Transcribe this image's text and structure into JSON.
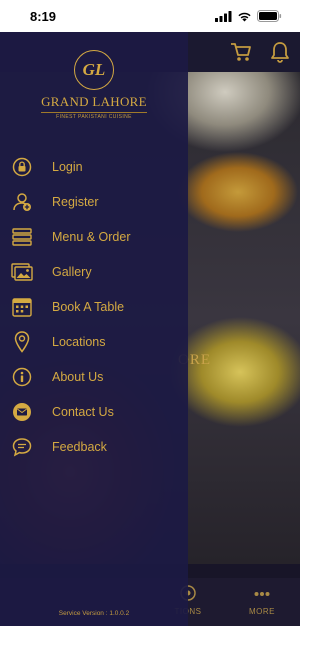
{
  "status_bar": {
    "time": "8:19"
  },
  "app": {
    "background_text": "ORE",
    "bottom_nav": [
      {
        "label": "TIONS",
        "icon": "location-pin-icon"
      },
      {
        "label": "MORE",
        "icon": "more-dots-icon"
      }
    ]
  },
  "drawer": {
    "logo": {
      "monogram": "GL",
      "name": "GRAND LAHORE",
      "tagline": "FINEST PAKISTANI CUISINE"
    },
    "items": [
      {
        "label": "Login",
        "icon": "lock-icon"
      },
      {
        "label": "Register",
        "icon": "add-user-icon"
      },
      {
        "label": "Menu & Order",
        "icon": "menu-list-icon"
      },
      {
        "label": "Gallery",
        "icon": "gallery-icon"
      },
      {
        "label": "Book A Table",
        "icon": "calendar-icon"
      },
      {
        "label": "Locations",
        "icon": "location-pin-icon"
      },
      {
        "label": "About Us",
        "icon": "info-icon"
      },
      {
        "label": "Contact Us",
        "icon": "mail-icon"
      },
      {
        "label": "Feedback",
        "icon": "chat-bubble-icon"
      }
    ],
    "version": "Service Version : 1.0.0.2"
  },
  "colors": {
    "accent_gold": "#d4a942",
    "drawer_bg": "#1c1a44",
    "nav_bg": "#1e1a30"
  }
}
